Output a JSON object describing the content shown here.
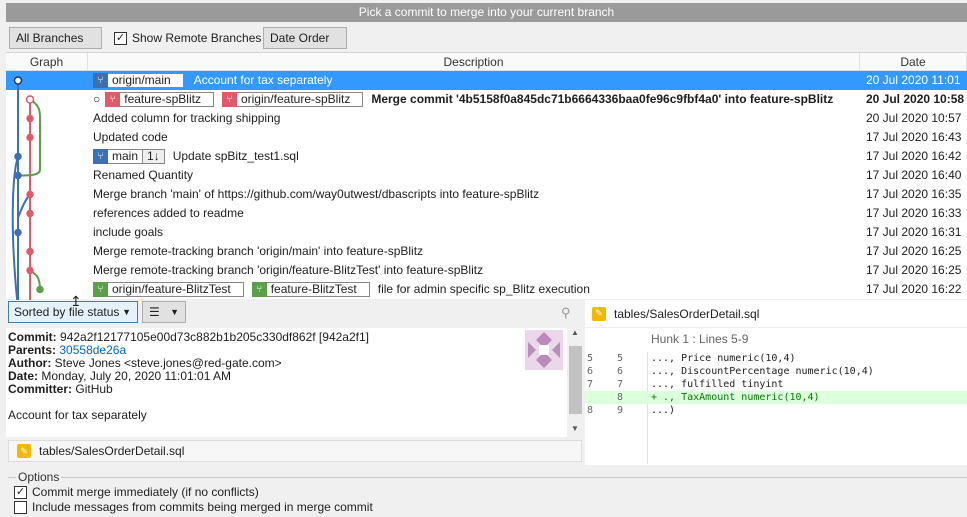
{
  "title": "Pick a commit to merge into your current branch",
  "toolbar": {
    "branches_label": "All Branches",
    "show_remote_label": "Show Remote Branches",
    "show_remote_checked": true,
    "order_label": "Date Order"
  },
  "columns": {
    "graph": "Graph",
    "description": "Description",
    "date": "Date"
  },
  "commits": [
    {
      "tags": [
        {
          "label": "origin/main",
          "color": "#3d6fb4"
        }
      ],
      "message": "Account for tax separately",
      "date": "20 Jul 2020 11:01",
      "selected": true,
      "bold": false
    },
    {
      "tags": [
        {
          "label": "feature-spBlitz",
          "color": "#e05a6a"
        },
        {
          "label": "origin/feature-spBlitz",
          "color": "#e05a6a"
        }
      ],
      "message": "Merge commit '4b5158f0a845dc71b6664336baa0fe96c9fbf4a0' into feature-spBlitz",
      "date": "20 Jul 2020 10:58",
      "selected": false,
      "bold": true
    },
    {
      "tags": [],
      "message": "Added column for tracking shipping",
      "date": "20 Jul 2020 10:57",
      "selected": false,
      "bold": false
    },
    {
      "tags": [],
      "message": "Updated code",
      "date": "17 Jul 2020 16:43",
      "selected": false,
      "bold": false
    },
    {
      "tags": [
        {
          "label": "main",
          "color": "#3d6fb4",
          "extra": "1↓"
        }
      ],
      "message": "Update spBitz_test1.sql",
      "date": "17 Jul 2020 16:42",
      "selected": false,
      "bold": false
    },
    {
      "tags": [],
      "message": "Renamed Quantity",
      "date": "17 Jul 2020 16:40",
      "selected": false,
      "bold": false
    },
    {
      "tags": [],
      "message": "Merge branch 'main' of https://github.com/way0utwest/dbascripts into feature-spBlitz",
      "date": "17 Jul 2020 16:35",
      "selected": false,
      "bold": false
    },
    {
      "tags": [],
      "message": "references added to readme",
      "date": "17 Jul 2020 16:33",
      "selected": false,
      "bold": false
    },
    {
      "tags": [],
      "message": "include goals",
      "date": "17 Jul 2020 16:31",
      "selected": false,
      "bold": false
    },
    {
      "tags": [],
      "message": "Merge remote-tracking branch 'origin/main' into feature-spBlitz",
      "date": "17 Jul 2020 16:25",
      "selected": false,
      "bold": false
    },
    {
      "tags": [],
      "message": "Merge remote-tracking branch 'origin/feature-BlitzTest' into feature-spBlitz",
      "date": "17 Jul 2020 16:25",
      "selected": false,
      "bold": false
    },
    {
      "tags": [
        {
          "label": "origin/feature-BlitzTest",
          "color": "#5aa04a"
        },
        {
          "label": "feature-BlitzTest",
          "color": "#5aa04a"
        }
      ],
      "message": "file for admin specific sp_Blitz execution",
      "date": "17 Jul 2020 16:22",
      "selected": false,
      "bold": false
    }
  ],
  "files_panel": {
    "sort_label": "Sorted by file status"
  },
  "commit_detail": {
    "commit_label": "Commit:",
    "commit_value": "942a2f12177105e00d73c882b1b205c330df862f [942a2f1]",
    "parents_label": "Parents:",
    "parents_value": "30558de26a",
    "author_label": "Author:",
    "author_value": "Steve Jones <steve.jones@red-gate.com>",
    "date_label": "Date:",
    "date_value": "Monday, July 20, 2020 11:01:01 AM",
    "committer_label": "Committer:",
    "committer_value": "GitHub",
    "message": "Account for tax separately"
  },
  "changed_file": "tables/SalesOrderDetail.sql",
  "diff": {
    "file": "tables/SalesOrderDetail.sql",
    "hunk": "Hunk 1 : Lines 5-9",
    "lines": [
      {
        "old": "5",
        "new": "5",
        "text": "..., Price numeric(10,4)",
        "added": false
      },
      {
        "old": "6",
        "new": "6",
        "text": "..., DiscountPercentage numeric(10,4)",
        "added": false
      },
      {
        "old": "7",
        "new": "7",
        "text": "..., fulfilled tinyint",
        "added": false
      },
      {
        "old": "",
        "new": "8",
        "text": "+ ., TaxAmount numeric(10,4)",
        "added": true
      },
      {
        "old": "8",
        "new": "9",
        "text": "...)",
        "added": false
      }
    ]
  },
  "options": {
    "legend": "Options",
    "commit_immediately_label": "Commit merge immediately (if no conflicts)",
    "commit_immediately_checked": true,
    "include_messages_label": "Include messages from commits being merged in merge commit",
    "include_messages_checked": false
  }
}
